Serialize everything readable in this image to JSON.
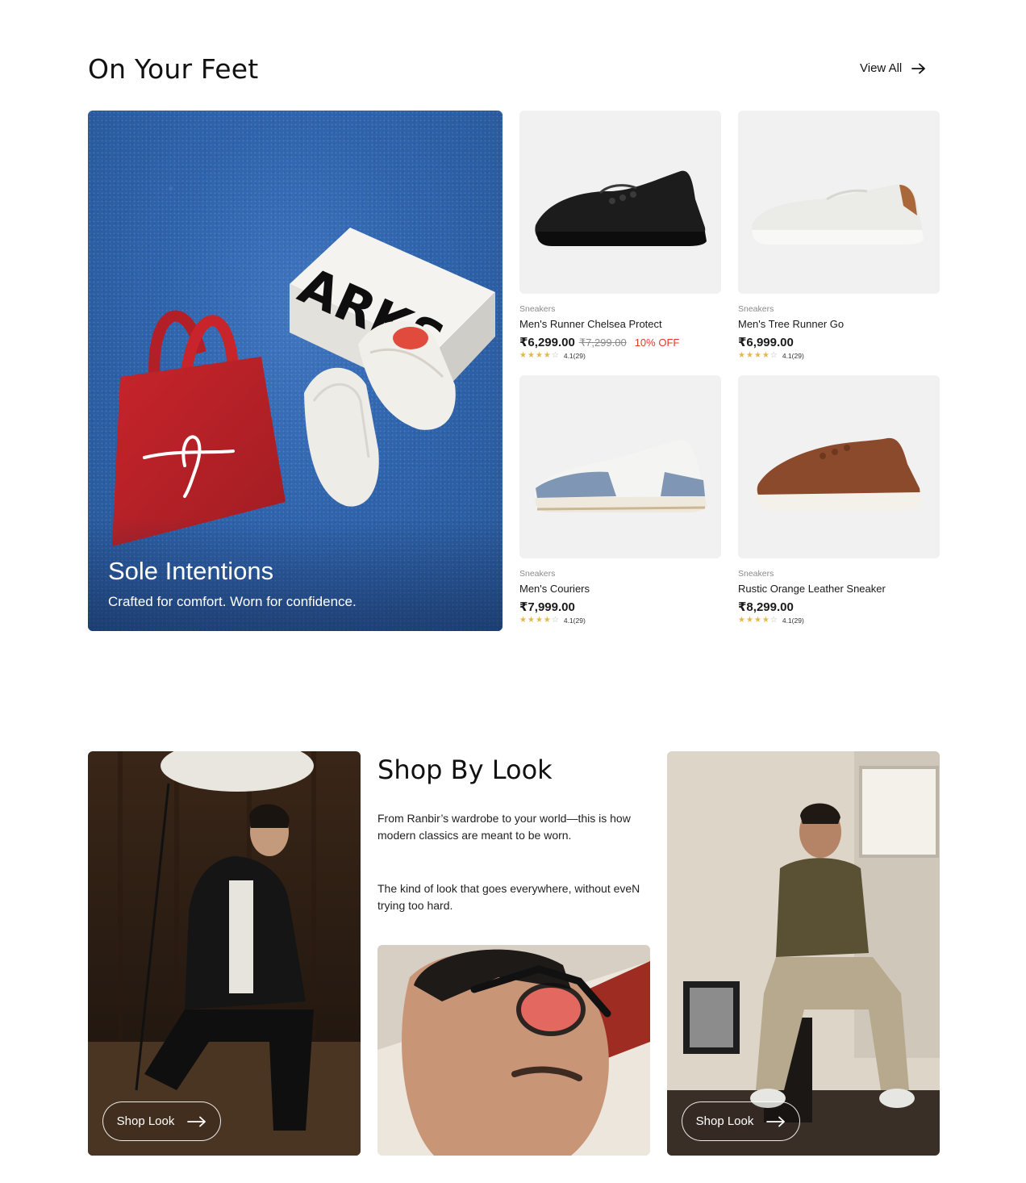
{
  "section_feet": {
    "title": "On Your Feet",
    "view_all_label": "View All"
  },
  "hero": {
    "title": "Sole Intentions",
    "subtitle": "Crafted for comfort. Worn for confidence.",
    "box_brand": "ARKS",
    "colors": {
      "background": "#2f64ad",
      "tote": "#c8242b"
    }
  },
  "products": [
    {
      "category": "Sneakers",
      "name": "Men's Runner Chelsea Protect",
      "price": "₹6,299.00",
      "mrp": "₹7,299.00",
      "discount": "10% OFF",
      "stars": 4,
      "rating": "4.1",
      "reviews": "(29)",
      "color": "#1c1c1c"
    },
    {
      "category": "Sneakers",
      "name": "Men's Tree Runner Go",
      "price": "₹6,999.00",
      "stars": 4,
      "rating": "4.1",
      "reviews": "(29)",
      "color": "#e8e8e6"
    },
    {
      "category": "Sneakers",
      "name": "Men's Couriers",
      "price": "₹7,999.00",
      "stars": 4,
      "rating": "4.1",
      "reviews": "(29)",
      "color": "#7f97b5"
    },
    {
      "category": "Sneakers",
      "name": "Rustic Orange Leather Sneaker",
      "price": "₹8,299.00",
      "stars": 4,
      "rating": "4.1",
      "reviews": "(29)",
      "color": "#8c4a2c"
    }
  ],
  "section_look": {
    "title": "Shop By Look",
    "paragraph_1": "From Ranbir’s wardrobe to your world—this is how modern classics are meant to be worn.",
    "paragraph_2": "The kind of look that goes everywhere, without eveN trying too hard.",
    "left_button_label": "Shop Look",
    "right_button_label": "Shop Look"
  },
  "icons": {
    "view_all": "arrow-right-icon",
    "shop_look": "long-arrow-right-icon",
    "rating": "star-icon"
  },
  "accent_colors": {
    "discount": "#e0392b",
    "star": "#e6b84a"
  }
}
